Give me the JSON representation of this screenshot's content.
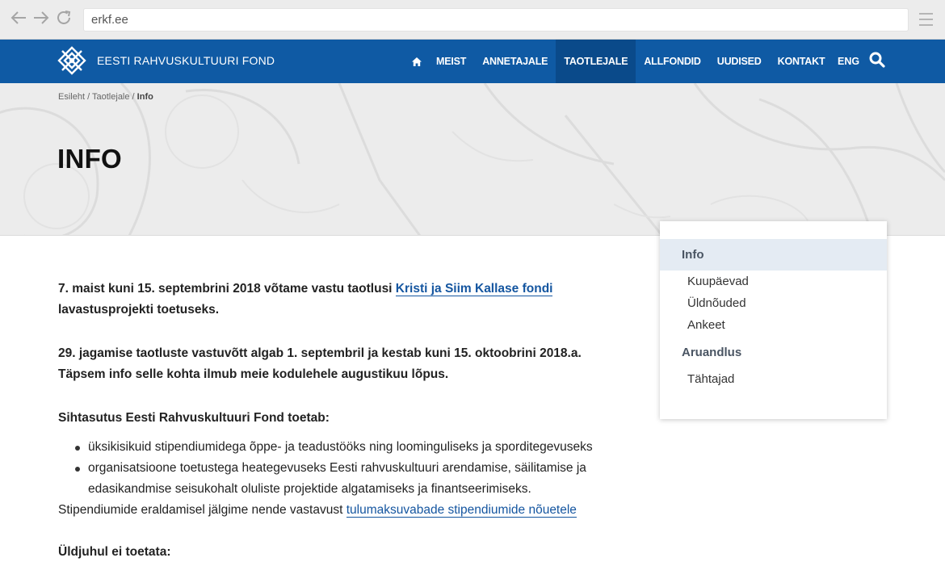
{
  "browser": {
    "url": "erkf.ee"
  },
  "header": {
    "logo_text": "EESTI RAHVUSKULTUURI FOND",
    "nav": [
      "MEIST",
      "ANNETAJALE",
      "TAOTLEJALE",
      "ALLFONDID",
      "UUDISED",
      "KONTAKT"
    ],
    "active": "TAOTLEJALE",
    "lang": "ENG",
    "brand_color": "#0f5aa4",
    "active_color": "#0a4a8a"
  },
  "breadcrumb": {
    "home": "Esileht",
    "sep1": " / ",
    "parent": "Taotlejale",
    "sep2": " / ",
    "current": "Info"
  },
  "page": {
    "title": "INFO"
  },
  "content": {
    "p1_text": "7. maist kuni 15. septembrini 2018 võtame vastu taotlusi ",
    "p1_link": "Kristi ja Siim Kallase fondi",
    "p1_tail": "lavastusprojekti toetuseks.",
    "p2_line1": "29. jagamise taotluste vastuvõtt algab 1. septembril ja kestab kuni 15. oktoobrini 2018.a.",
    "p2_line2": "Täpsem info selle kohta ilmub meie kodulehele augustikuu lõpus.",
    "p3_heading": "Sihtasutus Eesti Rahvuskultuuri Fond toetab:",
    "bullets": [
      "üksikisikuid stipendiumidega õppe- ja teadustööks ning loominguliseks ja sporditegevuseks",
      "organisatsioone toetustega heategevuseks Eesti rahvuskultuuri arendamise, säilitamise ja edasikandmise seisukohalt oluliste projektide algatamiseks ja finantseerimiseks."
    ],
    "p4_text": "Stipendiumide eraldamisel jälgime nende vastavust ",
    "p4_link": "tulumaksuvabade stipendiumide nõuetele",
    "p5_heading": "Üldjuhul ei toetata:"
  },
  "sidebar": {
    "info": "Info",
    "info_items": [
      "Kuupäevad",
      "Üldnõuded",
      "Ankeet"
    ],
    "report": "Aruandlus",
    "report_items": [
      "Tähtajad"
    ]
  }
}
